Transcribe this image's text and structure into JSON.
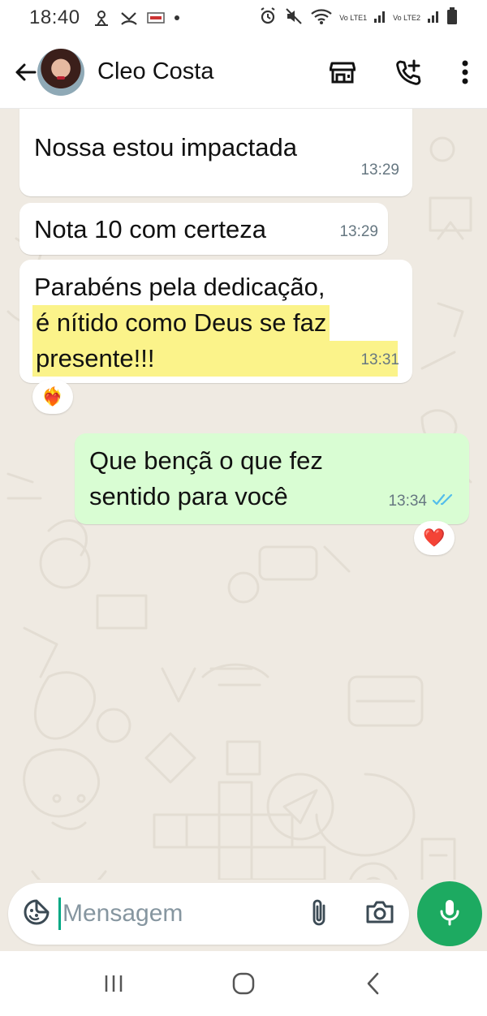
{
  "status_bar": {
    "time": "18:40",
    "network_1": "Vo LTE1",
    "network_2": "Vo LTE2"
  },
  "header": {
    "contact_name": "Cleo Costa"
  },
  "messages": [
    {
      "text": "Nossa estou impactada",
      "time": "13:29",
      "direction": "in"
    },
    {
      "text": "Nota 10 com certeza",
      "time": "13:29",
      "direction": "in"
    },
    {
      "text_line_1": "Parabéns pela dedicação,",
      "text_line_2": "é nítido como Deus se faz",
      "text_line_3": "presente!!!",
      "time": "13:31",
      "direction": "in",
      "reaction": "❤️‍🔥"
    },
    {
      "text_line_1": "Que bençã o que fez",
      "text_line_2": "sentido para você",
      "time": "13:34",
      "direction": "out",
      "status": "read",
      "reaction": "❤️"
    }
  ],
  "composer": {
    "placeholder": "Mensagem"
  },
  "colors": {
    "accent": "#1daa61",
    "outgoing_bubble": "#d9fdd3",
    "read_ticks": "#53bdeb",
    "highlight": "#fbf38a"
  }
}
